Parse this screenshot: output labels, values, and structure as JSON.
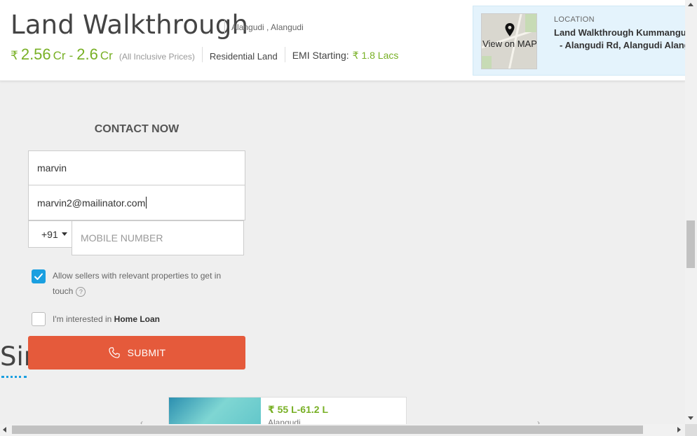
{
  "header": {
    "title": "Land Walkthrough",
    "title_location": "Alangudi , Alangudi",
    "price_symbol": "₹",
    "price_low": "2.56",
    "price_low_unit": "Cr",
    "price_separator": "-",
    "price_high": "2.6",
    "price_high_unit": "Cr",
    "price_note": "(All Inclusive Prices)",
    "property_type": "Residential Land",
    "emi_label": "EMI Starting:",
    "emi_value": "₹ 1.8 Lacs"
  },
  "location_card": {
    "map_link": "View on MAP",
    "label": "LOCATION",
    "address_line1": "Land Walkthrough Kummangudi",
    "address_line2": "- Alangudi Rd, Alangudi Alangudi"
  },
  "contact_form": {
    "title": "CONTACT NOW",
    "name_value": "marvin",
    "email_value": "marvin2@mailinator.com",
    "country_code": "+91",
    "mobile_placeholder": "MOBILE NUMBER",
    "allow_sellers_text": "Allow sellers with relevant properties to get in touch",
    "allow_sellers_checked": true,
    "home_loan_prefix": "I'm interested in",
    "home_loan_bold": "Home Loan",
    "home_loan_checked": false,
    "help_icon_glyph": "?",
    "submit_label": "SUBMIT"
  },
  "similar": {
    "title_visible": "Sim",
    "card_price": "₹ 55 L-61.2 L",
    "card_location": "Alangudi",
    "prev_arrow": "‹",
    "next_arrow": "›"
  },
  "colors": {
    "accent_green": "#78b025",
    "submit_orange": "#e55a3b",
    "checkbox_blue": "#1a9fe0",
    "location_bg": "#e4f3fc"
  },
  "icons": {
    "map_pin": "map-pin-icon",
    "phone": "phone-icon",
    "check": "checkmark-icon",
    "help": "help-icon",
    "dropdown": "chevron-down-icon"
  }
}
